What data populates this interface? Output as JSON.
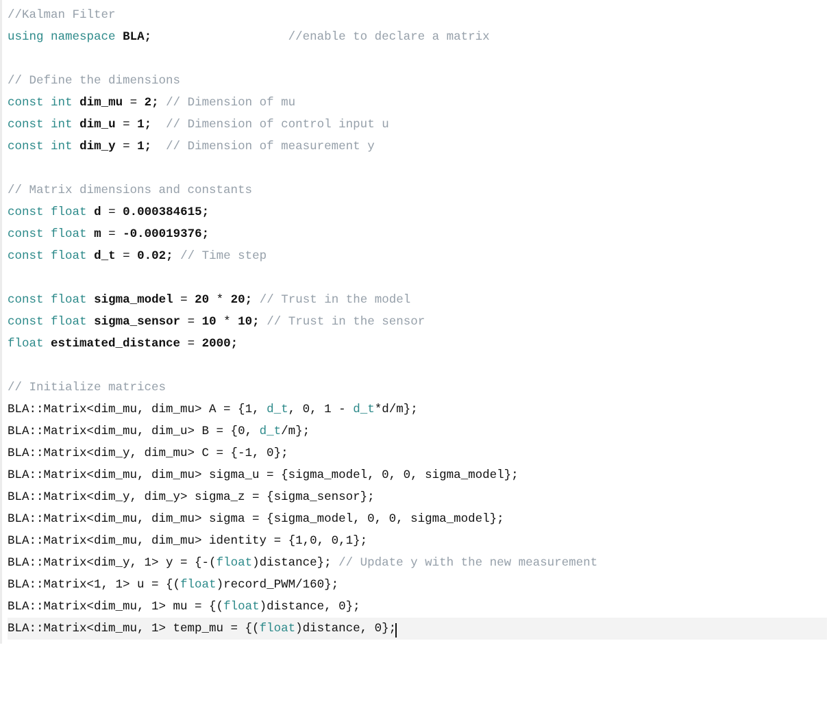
{
  "code": {
    "l01_comment": "//Kalman Filter",
    "l02_using": "using",
    "l02_namespace": "namespace",
    "l02_bla": "BLA",
    "l02_semi": ";",
    "l02_pad": "                   ",
    "l02_comment": "//enable to declare a matrix",
    "l04_comment": "// Define the dimensions",
    "l05_const": "const",
    "l05_int": "int",
    "l05_var": "dim_mu",
    "l05_eq": " = ",
    "l05_val": "2",
    "l05_semi": ";",
    "l05_pad": " ",
    "l05_comment": "// Dimension of mu",
    "l06_var": "dim_u",
    "l06_val": "1",
    "l06_pad": "  ",
    "l06_comment": "// Dimension of control input u",
    "l07_var": "dim_y",
    "l07_val": "1",
    "l07_pad": "  ",
    "l07_comment": "// Dimension of measurement y",
    "l09_comment": "// Matrix dimensions and constants",
    "l10_float": "float",
    "l10_var": "d",
    "l10_val": "0.000384615",
    "l11_var": "m",
    "l11_val": "-0.00019376",
    "l12_var": "d_t",
    "l12_val": "0.02",
    "l12_pad": " ",
    "l12_comment": "// Time step",
    "l14_var": "sigma_model",
    "l14_lhs": "20",
    "l14_star": " * ",
    "l14_rhs": "20",
    "l14_pad": " ",
    "l14_comment": "// Trust in the model",
    "l15_var": "sigma_sensor",
    "l15_lhs": "10",
    "l15_rhs": "10",
    "l15_pad": " ",
    "l15_comment": "// Trust in the sensor",
    "l16_var": "estimated_distance",
    "l16_val": "2000",
    "l18_comment": "// Initialize matrices",
    "l19_pre": "BLA::Matrix<dim_mu, dim_mu> A = {",
    "l19_a1": "1",
    "l19_sep": ", ",
    "l19_a2": "d_t",
    "l19_a3": "0",
    "l19_a4a": "1",
    "l19_minus": " - ",
    "l19_a4b": "d_t",
    "l19_tail": "*d/m};",
    "l20_pre": "BLA::Matrix<dim_mu, dim_u> B = {",
    "l20_b1": "0",
    "l20_b2": "d_t",
    "l20_tail": "/m};",
    "l21_full": "BLA::Matrix<dim_y, dim_mu> C = {-1, 0};",
    "l22_full": "BLA::Matrix<dim_mu, dim_mu> sigma_u = {sigma_model, 0, 0, sigma_model};",
    "l23_full": "BLA::Matrix<dim_y, dim_y> sigma_z = {sigma_sensor};",
    "l24_full": "BLA::Matrix<dim_mu, dim_mu> sigma = {sigma_model, 0, 0, sigma_model};",
    "l25_full": "BLA::Matrix<dim_mu, dim_mu> identity = {1,0, 0,1};",
    "l26_pre": "BLA::Matrix<dim_y, 1> y = {-(",
    "l26_cast": "float",
    "l26_post": ")distance};",
    "l26_pad": " ",
    "l26_comment": "// Update y with the new measurement",
    "l27_pre": "BLA::Matrix<1, 1> u = {(",
    "l27_cast": "float",
    "l27_post": ")record_PWM/160};",
    "l28_pre": "BLA::Matrix<dim_mu, 1> mu = {(",
    "l28_cast": "float",
    "l28_post": ")distance, 0};",
    "l29_pre": "BLA::Matrix<dim_mu, 1> temp_mu = {(",
    "l29_cast": "float",
    "l29_post": ")distance, 0};"
  },
  "colors": {
    "keyword": "#2d8a8a",
    "comment": "#96a0aa",
    "text": "#111111",
    "highlight_bg": "#f3f3f3",
    "gutter_border": "#ececec"
  }
}
